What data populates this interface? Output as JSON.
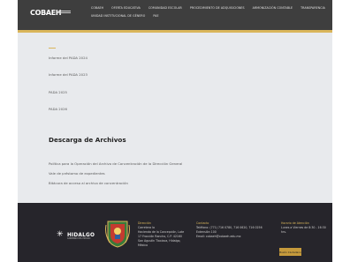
{
  "header": {
    "logo": "COBAEH",
    "nav": [
      "COBAEH",
      "OFERTA EDUCATIVA",
      "COMUNIDAD ESCOLAR",
      "PROCEDIMIENTO DE ADQUISICIONES",
      "ARMONIZACIÓN CONTABLE",
      "TRANSPARENCIA",
      "UNIDAD INSTITUCIONAL DE GÉNERO",
      "PAE"
    ]
  },
  "reports": [
    "Informe del PADA 2024",
    "Informe del PADA 2023",
    "PADA 2025",
    "PADA 2026"
  ],
  "downloads": {
    "title": "Descarga de Archivos",
    "items": [
      "Política para la Operación del Archivo de Concentración de la Dirección General",
      "Vale de préstamo de expedientes",
      "Bitácora de acceso al archivo de concentración"
    ]
  },
  "footer": {
    "brand": "HIDALGO",
    "brand_sub": "GOBIERNO DEL ESTADO",
    "address": {
      "title": "Dirección",
      "lines": [
        "Carretera la",
        "Hacienda de la Concepción, Lote",
        "17 Fracción Rancho, C.P. 42160",
        "San Agustín Tlaxiaca, Hidalgo,",
        "México"
      ]
    },
    "contact": {
      "title": "Contacto",
      "lines": [
        "Teléfono: (771) 716 0780, 716 0620, 716 0256",
        "Extensión 100",
        "Email: cobaeh@cobaeh.edu.mx"
      ]
    },
    "hours": {
      "title": "Horario de Atención",
      "lines": [
        "Lunes a Viernes de 8:30 - 16:30",
        "hrs."
      ]
    },
    "chat_label": "Buzón Ciudadano"
  }
}
